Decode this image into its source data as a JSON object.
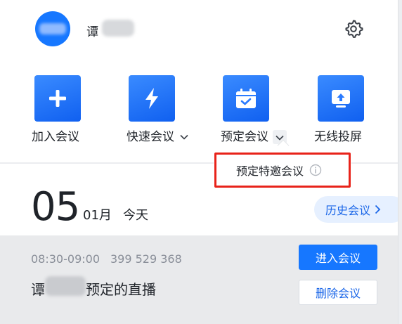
{
  "header": {
    "user_name": "谭",
    "settings_icon": "gear-icon"
  },
  "actions": [
    {
      "label": "加入会议",
      "icon": "plus-icon"
    },
    {
      "label": "快速会议",
      "icon": "lightning-icon",
      "has_dropdown": true
    },
    {
      "label": "预定会议",
      "icon": "calendar-check-icon",
      "has_dropdown": true
    },
    {
      "label": "无线投屏",
      "icon": "cast-screen-icon"
    }
  ],
  "popup": {
    "item_label": "预定特邀会议",
    "info_icon": "info-icon"
  },
  "date": {
    "day": "05",
    "month": "01月",
    "today": "今天"
  },
  "history_button": "历史会议",
  "meeting": {
    "time": "08:30-09:00",
    "id": "399 529 368",
    "title_prefix": "谭",
    "title_suffix": "预定的直播",
    "enter_button": "进入会议",
    "delete_button": "删除会议"
  },
  "colors": {
    "accent": "#1677ff",
    "highlight_border": "#e8231a",
    "card_bg": "#e9eaec"
  }
}
